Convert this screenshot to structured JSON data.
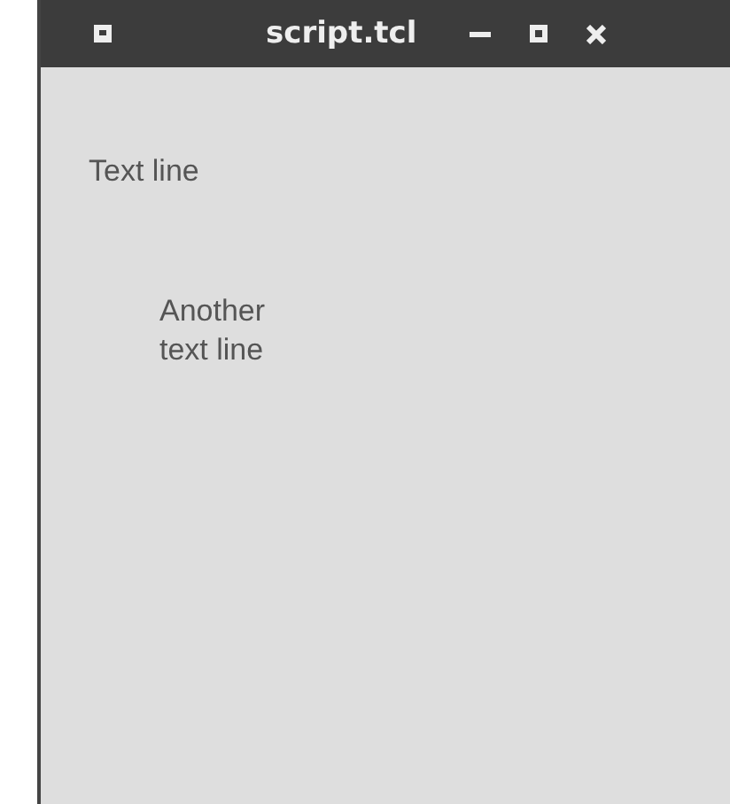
{
  "window": {
    "title": "script.tcl"
  },
  "labels": [
    {
      "text": "Text line"
    },
    {
      "text": "Another text line"
    }
  ]
}
